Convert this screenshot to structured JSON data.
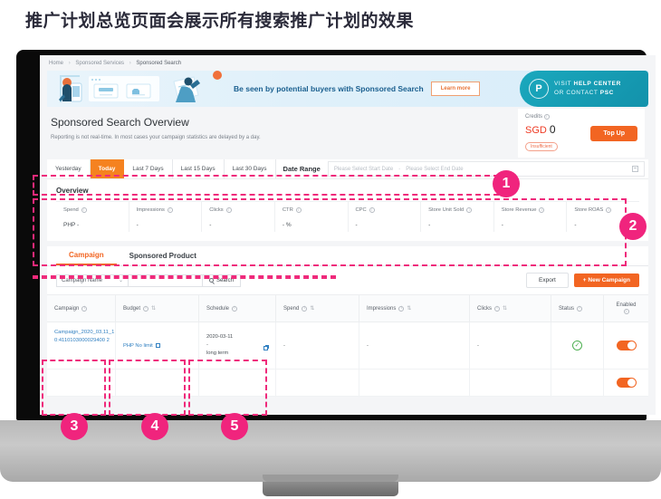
{
  "caption": "推广计划总览页面会展示所有搜索推广计划的效果",
  "breadcrumb": {
    "items": [
      "Home",
      "Sponsored Services",
      "Sponsored Search"
    ],
    "separator": "›"
  },
  "banner": {
    "text": "Be seen by potential buyers with Sponsored Search",
    "learn_more": "Learn more",
    "psc_line1_plain": "VISIT ",
    "psc_line1_bold": "HELP CENTER",
    "psc_line2_plain": "OR CONTACT ",
    "psc_line2_bold": "PSC",
    "psc_logo": "P"
  },
  "header": {
    "title": "Sponsored Search Overview",
    "subtitle": "Reporting is not real-time. In most cases your campaign statistics are delayed by a day."
  },
  "credits": {
    "label": "Credits",
    "currency": "SGD",
    "amount": "0",
    "status_badge": "Insufficient",
    "topup_label": "Top Up"
  },
  "filter": {
    "tabs": [
      {
        "label": "Yesterday",
        "active": false
      },
      {
        "label": "Today",
        "active": true
      },
      {
        "label": "Last 7 Days",
        "active": false
      },
      {
        "label": "Last 15 Days",
        "active": false
      },
      {
        "label": "Last 30 Days",
        "active": false
      }
    ],
    "date_range_label": "Date Range",
    "start_placeholder": "Please Select Start Date",
    "end_placeholder": "Please Select End Date",
    "range_dash": "-"
  },
  "overview": {
    "heading": "Overview",
    "metrics": [
      {
        "label": "Spend",
        "value": "PHP -"
      },
      {
        "label": "Impressions",
        "value": "-"
      },
      {
        "label": "Clicks",
        "value": "-"
      },
      {
        "label": "CTR",
        "value": "- %"
      },
      {
        "label": "CPC",
        "value": "-"
      },
      {
        "label": "Store Unit Sold",
        "value": "-"
      },
      {
        "label": "Store Revenue",
        "value": "-"
      },
      {
        "label": "Store ROAS",
        "value": "-"
      }
    ]
  },
  "content_tabs": [
    {
      "label": "Campaign",
      "active": true
    },
    {
      "label": "Sponsored Product",
      "active": false
    }
  ],
  "search": {
    "select_value": "Campaign Name",
    "caret": "⌄",
    "input_value": "",
    "search_label": "Search",
    "export_label": "Export",
    "new_campaign_label": "+ New Campaign"
  },
  "table": {
    "columns": [
      {
        "label": "Campaign",
        "sortable": false
      },
      {
        "label": "Budget",
        "sortable": true
      },
      {
        "label": "Schedule",
        "sortable": false
      },
      {
        "label": "Spend",
        "sortable": true
      },
      {
        "label": "Impressions",
        "sortable": true
      },
      {
        "label": "Clicks",
        "sortable": true
      },
      {
        "label": "Status",
        "sortable": false
      },
      {
        "label": "Enabled",
        "sortable": false
      }
    ],
    "sort_glyph": "⇅",
    "rows": [
      {
        "campaign": "Campaign_2020_03,11_10:4110103000029400 2",
        "budget": "PHP No limit",
        "schedule_start": "2020-03-11",
        "schedule_dash": "-",
        "schedule_end": "long term",
        "spend": "-",
        "impressions": "-",
        "clicks": "-",
        "status": "active",
        "enabled": "on"
      }
    ]
  },
  "annotations": {
    "badges": [
      "1",
      "2",
      "3",
      "4",
      "5"
    ]
  },
  "colors": {
    "brand_orange": "#f26522",
    "annotation_pink": "#f0247d",
    "link_blue": "#2f7fc1",
    "teal": "#1aa8bd",
    "status_green": "#4caf50"
  }
}
